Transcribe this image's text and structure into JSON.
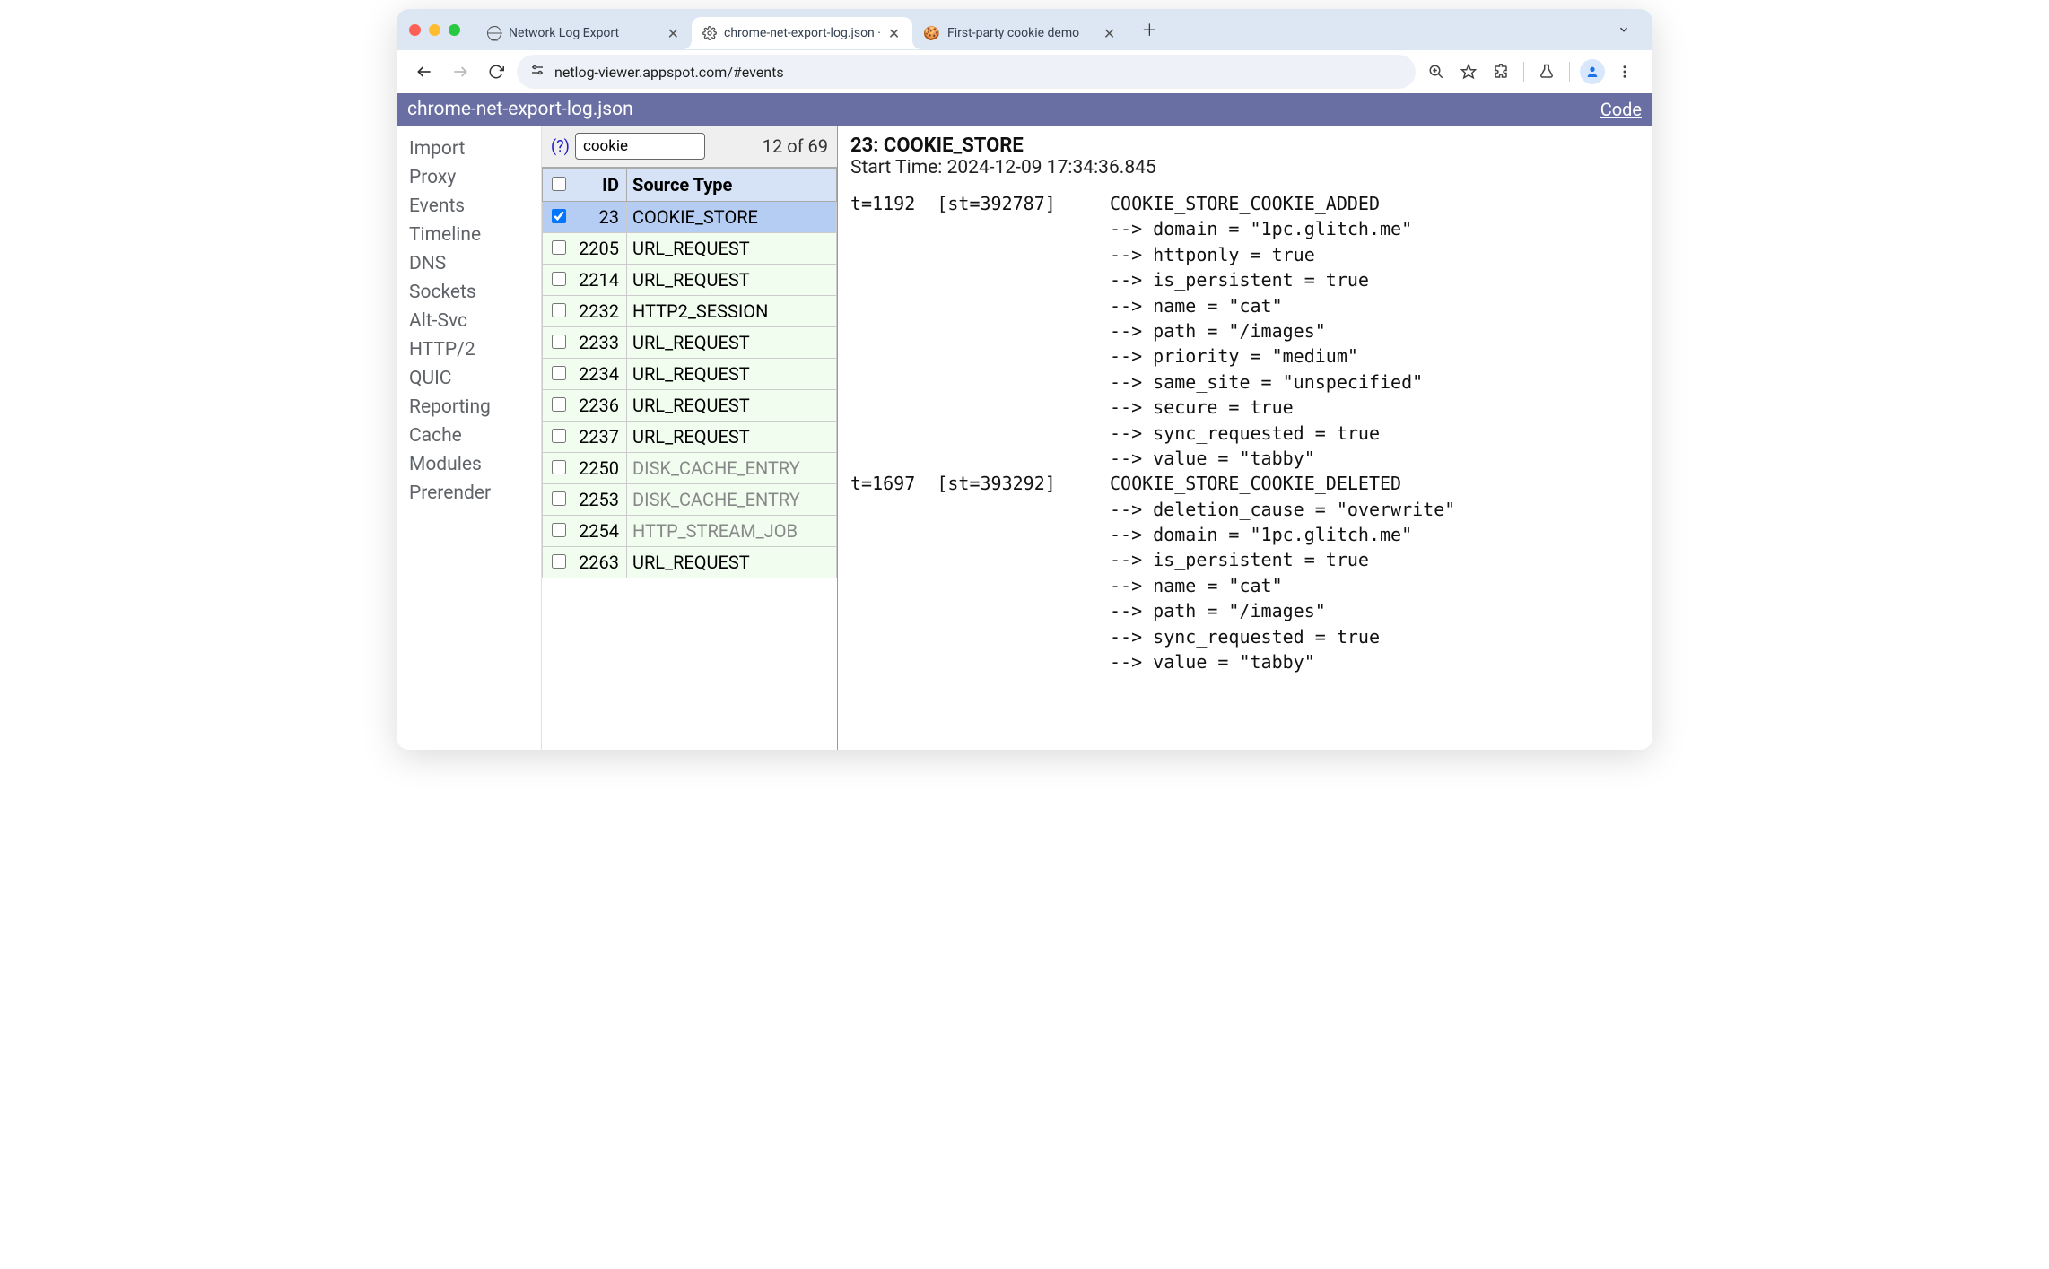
{
  "browser": {
    "tabs": [
      {
        "title": "Network Log Export",
        "active": false,
        "icon": "globe"
      },
      {
        "title": "chrome-net-export-log.json ·",
        "active": true,
        "icon": "cog"
      },
      {
        "title": "First-party cookie demo",
        "active": false,
        "icon": "cookie"
      }
    ],
    "url": "netlog-viewer.appspot.com/#events"
  },
  "app_header": {
    "title": "chrome-net-export-log.json",
    "code_link": "Code"
  },
  "nav": {
    "items": [
      "Import",
      "Proxy",
      "Events",
      "Timeline",
      "DNS",
      "Sockets",
      "Alt-Svc",
      "HTTP/2",
      "QUIC",
      "Reporting",
      "Cache",
      "Modules",
      "Prerender"
    ]
  },
  "filter": {
    "help": "(?)",
    "value": "cookie",
    "count": "12 of 69"
  },
  "table": {
    "col_id": "ID",
    "col_src": "Source Type",
    "rows": [
      {
        "id": "23",
        "src": "COOKIE_STORE",
        "selected": true,
        "dim": false
      },
      {
        "id": "2205",
        "src": "URL_REQUEST",
        "selected": false,
        "dim": false
      },
      {
        "id": "2214",
        "src": "URL_REQUEST",
        "selected": false,
        "dim": false
      },
      {
        "id": "2232",
        "src": "HTTP2_SESSION",
        "selected": false,
        "dim": false
      },
      {
        "id": "2233",
        "src": "URL_REQUEST",
        "selected": false,
        "dim": false
      },
      {
        "id": "2234",
        "src": "URL_REQUEST",
        "selected": false,
        "dim": false
      },
      {
        "id": "2236",
        "src": "URL_REQUEST",
        "selected": false,
        "dim": false
      },
      {
        "id": "2237",
        "src": "URL_REQUEST",
        "selected": false,
        "dim": false
      },
      {
        "id": "2250",
        "src": "DISK_CACHE_ENTRY",
        "selected": false,
        "dim": true
      },
      {
        "id": "2253",
        "src": "DISK_CACHE_ENTRY",
        "selected": false,
        "dim": true
      },
      {
        "id": "2254",
        "src": "HTTP_STREAM_JOB",
        "selected": false,
        "dim": true
      },
      {
        "id": "2263",
        "src": "URL_REQUEST",
        "selected": false,
        "dim": false
      }
    ]
  },
  "detail": {
    "heading_id": "23",
    "heading_type": "COOKIE_STORE",
    "start_label": "Start Time:",
    "start_time": "2024-12-09 17:34:36.845",
    "events": [
      {
        "t": "t=1192",
        "st": "[st=392787]",
        "name": "COOKIE_STORE_COOKIE_ADDED",
        "params": [
          "--> domain = \"1pc.glitch.me\"",
          "--> httponly = true",
          "--> is_persistent = true",
          "--> name = \"cat\"",
          "--> path = \"/images\"",
          "--> priority = \"medium\"",
          "--> same_site = \"unspecified\"",
          "--> secure = true",
          "--> sync_requested = true",
          "--> value = \"tabby\""
        ]
      },
      {
        "t": "t=1697",
        "st": "[st=393292]",
        "name": "COOKIE_STORE_COOKIE_DELETED",
        "params": [
          "--> deletion_cause = \"overwrite\"",
          "--> domain = \"1pc.glitch.me\"",
          "--> is_persistent = true",
          "--> name = \"cat\"",
          "--> path = \"/images\"",
          "--> sync_requested = true",
          "--> value = \"tabby\""
        ]
      }
    ]
  }
}
